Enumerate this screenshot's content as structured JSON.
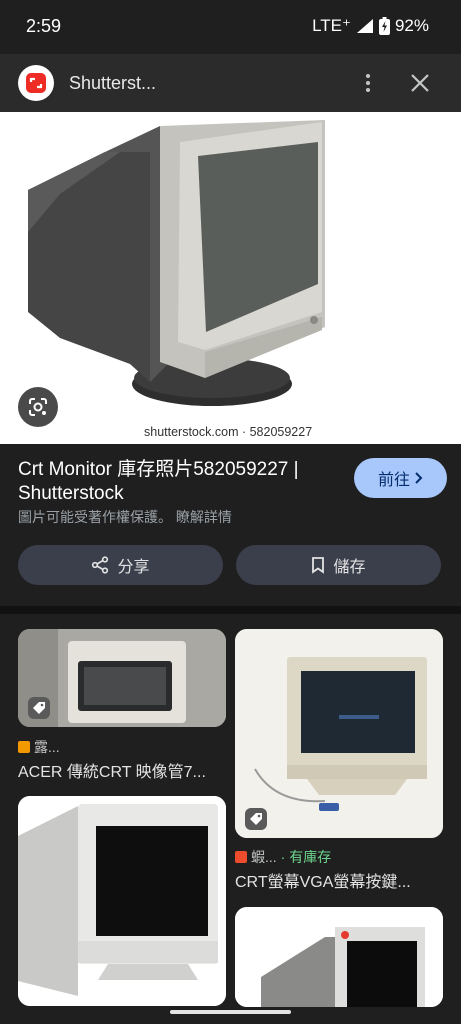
{
  "status_bar": {
    "time": "2:59",
    "network": "LTE⁺",
    "battery": "92%"
  },
  "header": {
    "site_name": "Shutterst...",
    "more_icon": "more-vert-icon",
    "close_icon": "close-icon"
  },
  "main_image": {
    "watermark": "shutterstock.com · 582059227",
    "lens_icon": "lens-icon"
  },
  "info": {
    "title": "Crt Monitor 庫存照片582059227 | Shutterstock",
    "visit_label": "前往",
    "copyright_note": "圖片可能受著作權保護。 瞭解詳情",
    "share_label": "分享",
    "save_label": "儲存"
  },
  "results": [
    {
      "source": "露...",
      "caption": "ACER 傳統CRT 映像管7...",
      "favicon_color": "#f29900"
    },
    {
      "source": "蝦...",
      "stock_label": "· 有庫存",
      "caption": "CRT螢幕VGA螢幕按鍵...",
      "favicon_color": "#ee4d2d"
    },
    {
      "source": "",
      "caption": ""
    },
    {
      "source": "",
      "caption": ""
    }
  ]
}
